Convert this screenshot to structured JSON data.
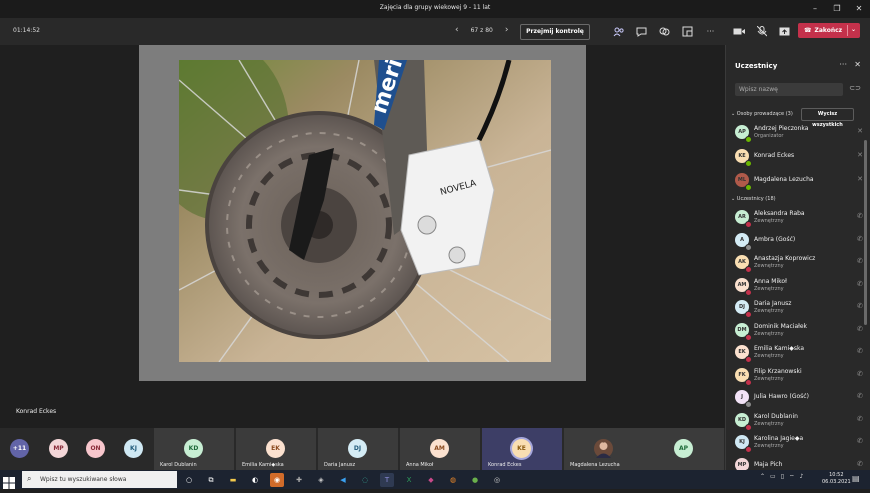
{
  "window": {
    "title": "Zajęcia dla grupy wiekowej 9 - 11 lat"
  },
  "toolbar": {
    "timer": "01:14:52",
    "page": "67 z 80",
    "take_control": "Przejmij kontrolę",
    "end_call": "Zakończ"
  },
  "stage": {
    "speaker_label": "Konrad Eckes"
  },
  "strip": {
    "overflow": "+11",
    "bubbles": [
      {
        "initials": "MP",
        "color": "#f3d6d8"
      },
      {
        "initials": "ON",
        "color": "#f7c6cc"
      },
      {
        "initials": "KJ",
        "color": "#cfe8f3"
      }
    ],
    "tiles": [
      {
        "initials": "KD",
        "name": "Karol Dublanin",
        "color": "#c7eed3"
      },
      {
        "initials": "EK",
        "name": "Emilia Kami◆ska",
        "color": "#fbe1cf"
      },
      {
        "initials": "DJ",
        "name": "Daria Janusz",
        "color": "#d4ecf5"
      },
      {
        "initials": "AM",
        "name": "Anna Mikoł",
        "color": "#fbe1cf"
      },
      {
        "initials": "KE",
        "name": "Konrad Eckes",
        "color": "#f9deb2"
      },
      {
        "initials": "",
        "name": "Magdalena Lezucha",
        "color": "#888888"
      },
      {
        "initials": "AP",
        "name": "",
        "color": "#c7eed3"
      }
    ]
  },
  "panel": {
    "title": "Uczestnicy",
    "search_placeholder": "Wpisz nazwę",
    "presenters_header": "Osoby prowadzące (3)",
    "see_all": "Wycisz wszystkich",
    "attendees_header": "Uczestnicy (18)",
    "presenters": [
      {
        "initials": "AP",
        "name": "Andrzej Pieczonka",
        "role": "Organizator",
        "color": "#c7eed3",
        "status": "#6bb700"
      },
      {
        "initials": "KE",
        "name": "Konrad Eckes",
        "role": "",
        "color": "#f9deb2",
        "status": "#6bb700"
      },
      {
        "initials": "ML",
        "name": "Magdalena Lezucha",
        "role": "",
        "color": "#b05a4a",
        "status": "#6bb700"
      }
    ],
    "attendees": [
      {
        "initials": "AR",
        "name": "Aleksandra Raba",
        "role": "Zewnętrzny",
        "color": "#c7eed3",
        "status": "#c4314b"
      },
      {
        "initials": "A",
        "name": "Ambra (Gość)",
        "role": "",
        "color": "#d4ecf5",
        "status": "#8a8a8a"
      },
      {
        "initials": "AK",
        "name": "Anastazja Koprowicz",
        "role": "Zewnętrzny",
        "color": "#f9deb2",
        "status": "#c4314b"
      },
      {
        "initials": "AM",
        "name": "Anna Mikoł",
        "role": "Zewnętrzny",
        "color": "#fbe1cf",
        "status": "#c4314b"
      },
      {
        "initials": "DJ",
        "name": "Daria Janusz",
        "role": "Zewnętrzny",
        "color": "#d4ecf5",
        "status": "#c4314b"
      },
      {
        "initials": "DM",
        "name": "Dominik Maciałek",
        "role": "Zewnętrzny",
        "color": "#c7eed3",
        "status": "#c4314b"
      },
      {
        "initials": "EK",
        "name": "Emilia Kami◆ska",
        "role": "Zewnętrzny",
        "color": "#fbe1cf",
        "status": "#c4314b"
      },
      {
        "initials": "FK",
        "name": "Filip Krzanowski",
        "role": "Zewnętrzny",
        "color": "#f9deb2",
        "status": "#c4314b"
      },
      {
        "initials": "J",
        "name": "Julia Hawro (Gość)",
        "role": "",
        "color": "#f3e3f7",
        "status": "#8a8a8a"
      },
      {
        "initials": "KD",
        "name": "Karol Dublanin",
        "role": "Zewnętrzny",
        "color": "#c7eed3",
        "status": "#c4314b"
      },
      {
        "initials": "KJ",
        "name": "Karolina Jagie◆a",
        "role": "Zewnętrzny",
        "color": "#cfe8f3",
        "status": "#c4314b"
      },
      {
        "initials": "MP",
        "name": "Maja Pich",
        "role": "",
        "color": "#f3d6d8",
        "status": "#c4314b"
      }
    ]
  },
  "taskbar": {
    "search_placeholder": "Wpisz tu wyszukiwane słowa",
    "time": "10:52",
    "date": "06.03.2021"
  }
}
